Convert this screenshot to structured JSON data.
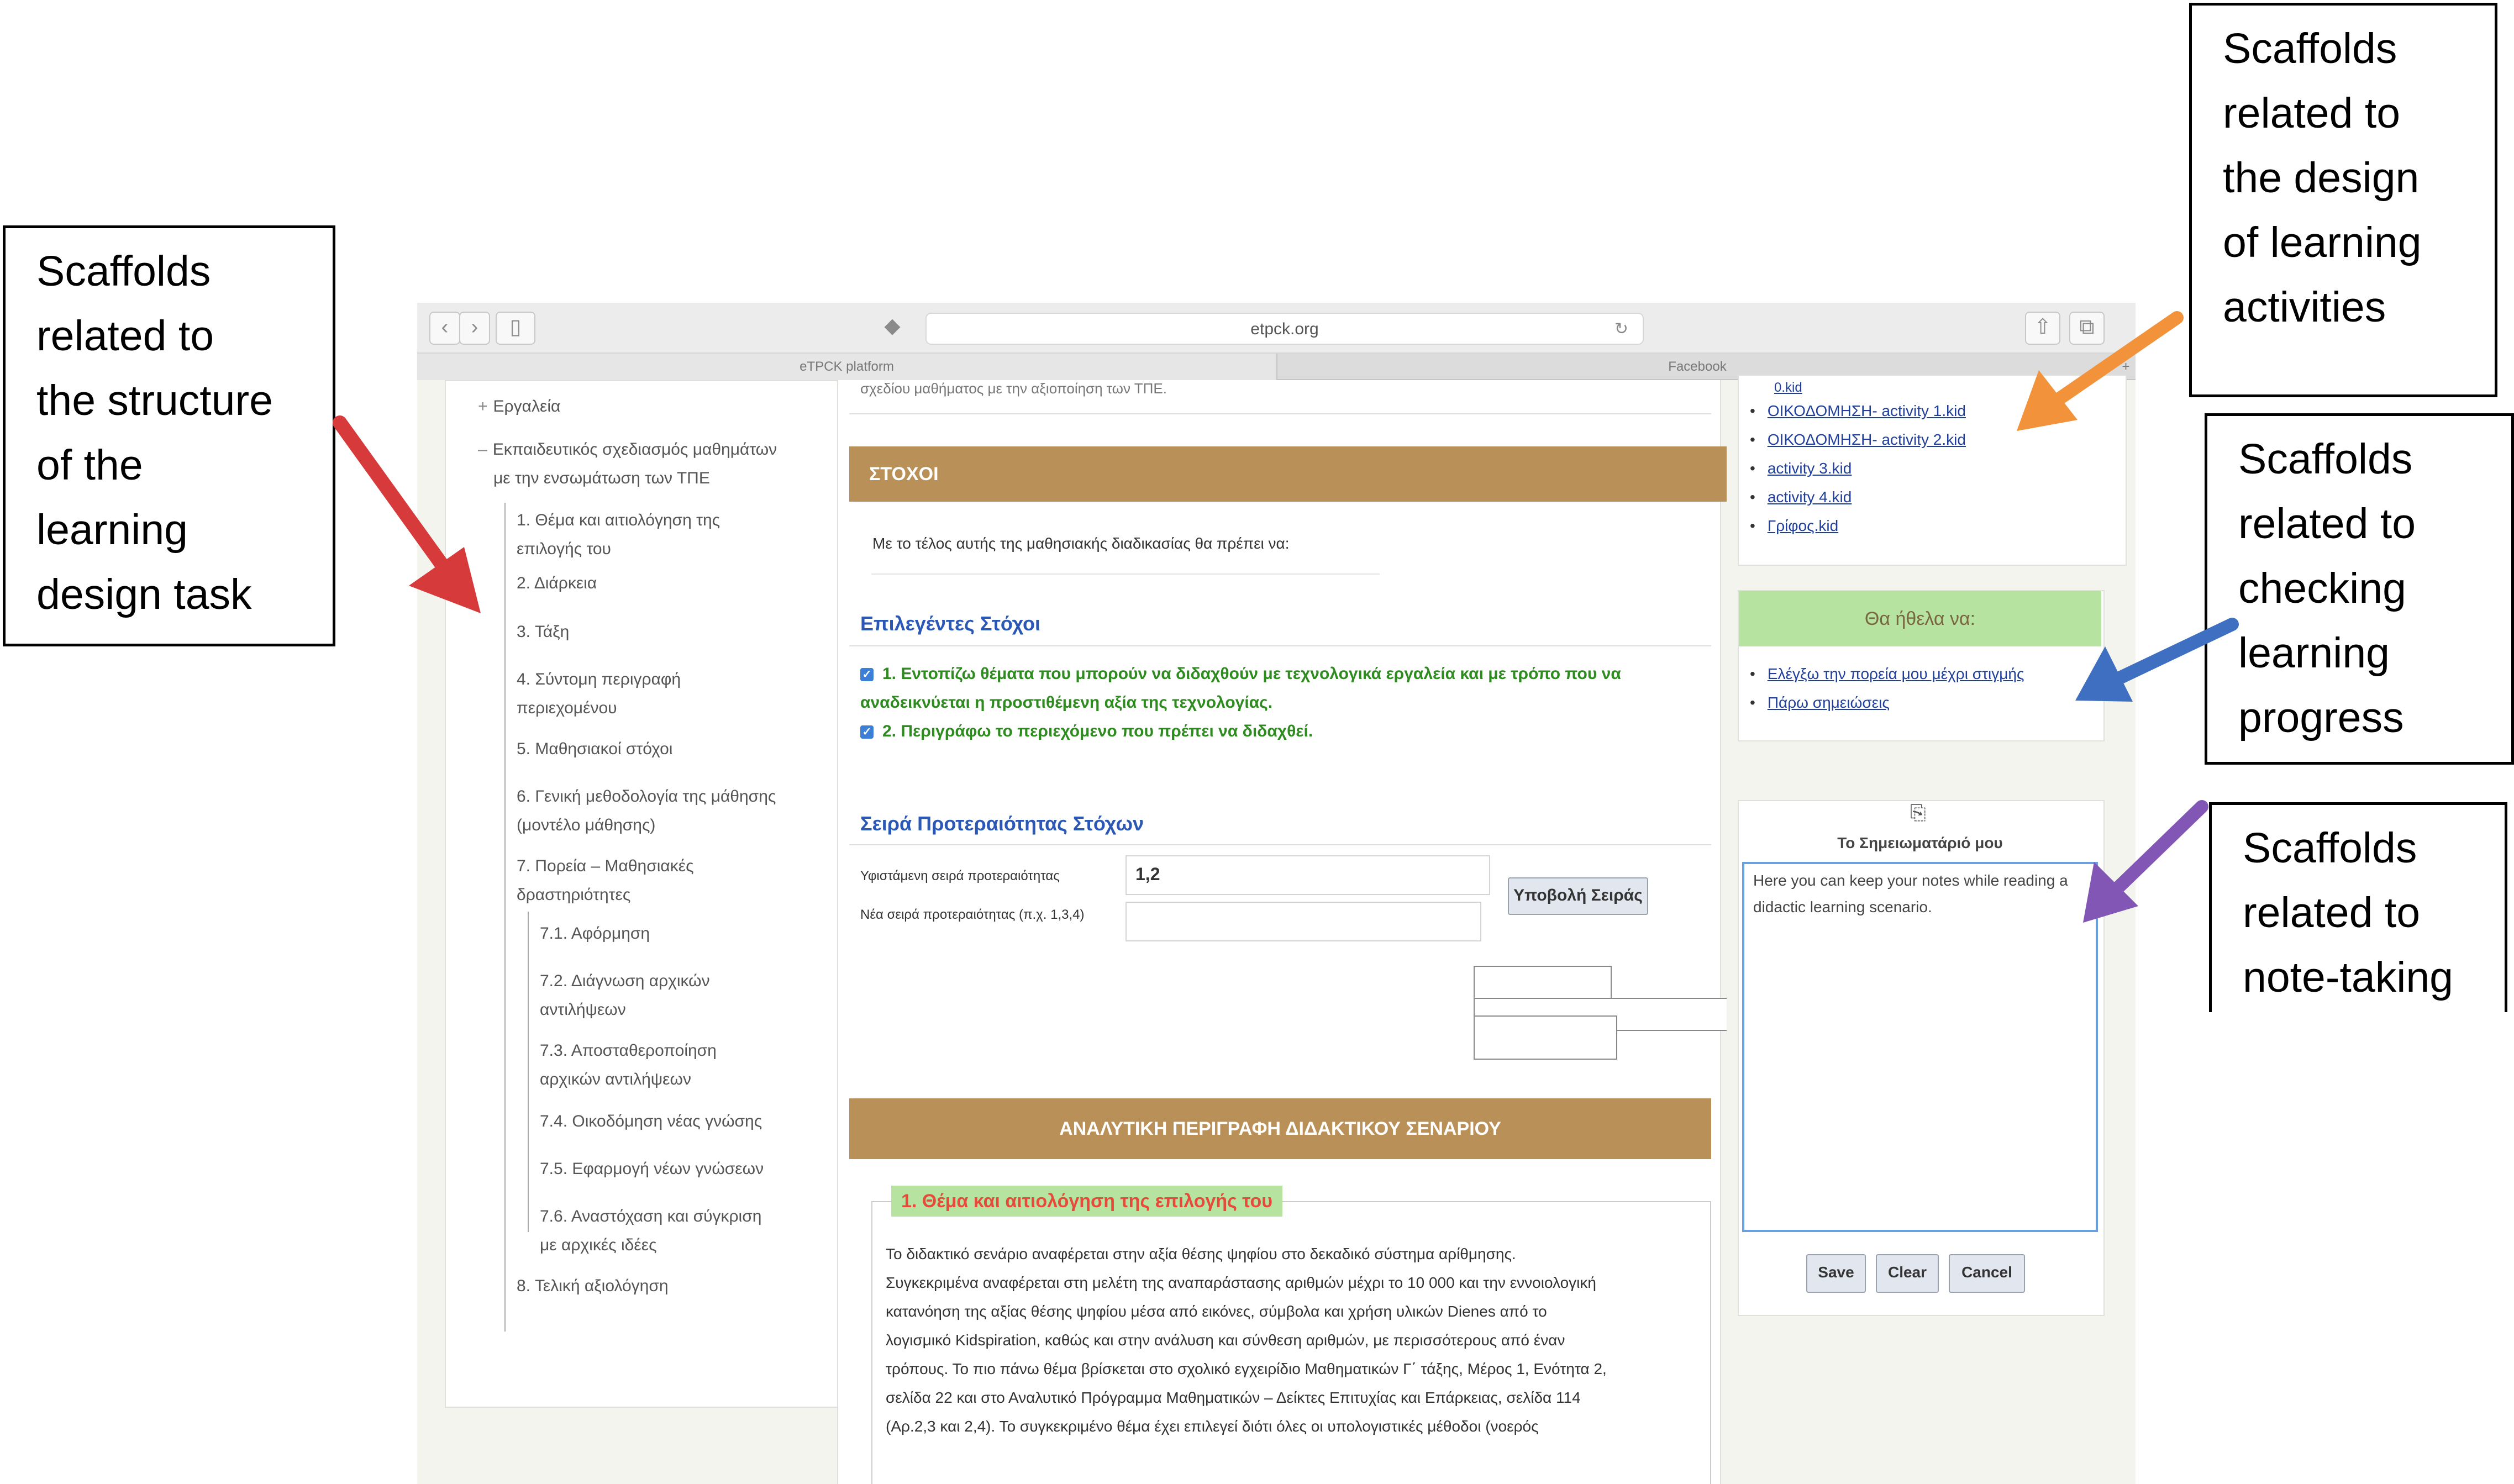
{
  "callouts": {
    "structure": [
      "Scaffolds",
      "related to",
      "the structure",
      "of the",
      "learning",
      "design task"
    ],
    "activities": [
      "Scaffolds",
      "related to",
      "the design",
      "of learning",
      "activities"
    ],
    "progress": [
      "Scaffolds",
      "related to",
      "checking",
      "learning",
      "progress"
    ],
    "notes": [
      "Scaffolds",
      "related to",
      "note-taking"
    ]
  },
  "browser": {
    "url": "etpck.org",
    "tabs": [
      "eTPCK platform",
      "Facebook"
    ]
  },
  "tree": {
    "tools": "Εργαλεία",
    "root": [
      "Εκπαιδευτικός σχεδιασμός μαθημάτων",
      "με την ενσωμάτωση των ΤΠΕ"
    ],
    "items": [
      [
        "1. Θέμα και αιτιολόγηση της",
        "επιλογής του"
      ],
      [
        "2. Διάρκεια"
      ],
      [
        "3. Τάξη"
      ],
      [
        "4. Σύντομη περιγραφή",
        "περιεχομένου"
      ],
      [
        "5. Μαθησιακοί στόχοι"
      ],
      [
        "6. Γενική μεθοδολογία της μάθησης",
        "(μοντέλο μάθησης)"
      ],
      [
        "7. Πορεία – Μαθησιακές",
        "δραστηριότητες"
      ]
    ],
    "subitems": [
      [
        "7.1. Αφόρμηση"
      ],
      [
        "7.2. Διάγνωση αρχικών",
        "αντιλήψεων"
      ],
      [
        "7.3. Αποσταθεροποίηση",
        "αρχικών αντιλήψεων"
      ],
      [
        "7.4. Οικοδόμηση νέας γνώσης"
      ],
      [
        "7.5. Εφαρμογή νέων γνώσεων"
      ],
      [
        "7.6. Αναστόχαση και σύγκριση",
        "με αρχικές ιδέες"
      ]
    ],
    "last": "8. Τελική αξιολόγηση"
  },
  "main": {
    "top_cut_text": "σχεδίου μαθήματος με την αξιοποίηση των ΤΠΕ.",
    "goals_header": "ΣΤΟΧΟΙ",
    "goals_intro": "Με το τέλος αυτής της μαθησιακής διαδικασίας θα πρέπει να:",
    "selected_goals_title": "Επιλεγέντες Στόχοι",
    "goal_1": "1. Εντοπίζω θέματα που μπορούν να διδαχθούν με τεχνολογικά εργαλεία και με τρόπο που να αναδεικνύεται η προστιθέμενη αξία της τεχνολογίας.",
    "goal_2": "2. Περιγράφω το περιεχόμενο που πρέπει να διδαχθεί.",
    "priority_title": "Σειρά Προτεραιότητας Στόχων",
    "current_label": "Υφιστάμενη σειρά προτεραιότητας",
    "current_value": "1,2",
    "new_label": "Νέα σειρά προτεραιότητας (π.χ. 1,3,4)",
    "new_value": "",
    "submit_label": "Υποβολή Σειράς",
    "desc_header": "ΑΝΑΛΥΤΙΚΗ ΠΕΡΙΓΡΑΦΗ ΔΙΔΑΚΤΙΚΟΥ ΣΕΝΑΡΙΟΥ",
    "section_legend": "1. Θέμα και αιτιολόγηση της επιλογής του",
    "paragraph": [
      "Το διδακτικό σενάριο αναφέρεται στην αξία θέσης ψηφίου στο δεκαδικό σύστημα αρίθμησης.",
      "Συγκεκριμένα αναφέρεται στη μελέτη της αναπαράστασης αριθμών μέχρι το 10 000 και την εννοιολογική",
      "κατανόηση της αξίας θέσης ψηφίου μέσα από εικόνες, σύμβολα και χρήση υλικών Dienes από το",
      "λογισμικό Kidspiration, καθώς και στην ανάλυση και σύνθεση αριθμών, με περισσότερους από έναν",
      "τρόπους. Το πιο πάνω θέμα βρίσκεται στο σχολικό εγχειρίδιο Μαθηματικών Γ΄ τάξης, Μέρος 1, Ενότητα 2,",
      "σελίδα 22 και στο Αναλυτικό Πρόγραμμα Μαθηματικών – Δείκτες Επιτυχίας και Επάρκειας, σελίδα 114",
      "(Αρ.2,3 και 2,4). Το συγκεκριμένο θέμα έχει επιλεγεί διότι όλες οι υπολογιστικές μέθοδοι (νοερός"
    ]
  },
  "right": {
    "files_cut": "0.kid",
    "files": [
      "ΟΙΚΟΔΟΜΗΣΗ- activity 1.kid",
      "ΟΙΚΟΔΟΜΗΣΗ- activity 2.kid",
      "activity 3.kid",
      "activity 4.kid",
      "Γρίφος.kid"
    ],
    "wish_title": "Θα ήθελα να:",
    "wish_links": [
      "Ελέγξω την πορεία μου μέχρι στιγμής",
      "Πάρω σημειώσεις"
    ],
    "notebook_title": "Το Σημειωματάριό μου",
    "notebook_text": "Here you can keep your notes while reading a didactic learning scenario.",
    "save_label": "Save",
    "clear_label": "Clear",
    "cancel_label": "Cancel"
  },
  "colors": {
    "gold_header": "#b99158",
    "green_header": "#b6e3a0",
    "arrow_red": "#d63a3a",
    "arrow_orange": "#f2923a",
    "arrow_blue": "#3f6fc0",
    "arrow_purple": "#8156b5"
  }
}
